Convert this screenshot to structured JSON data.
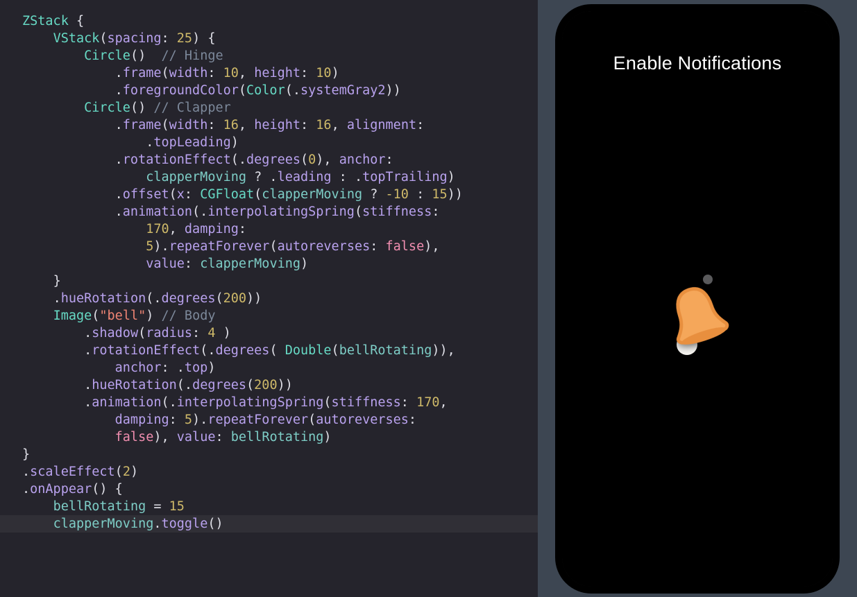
{
  "editor": {
    "lines": [
      {
        "i": 0,
        "seg": [
          {
            "c": "typeT",
            "t": "ZStack"
          },
          {
            "c": "op",
            "t": " {"
          }
        ]
      },
      {
        "i": 1,
        "seg": [
          {
            "c": "typeT",
            "t": "VStack"
          },
          {
            "c": "op",
            "t": "("
          },
          {
            "c": "typeP",
            "t": "spacing"
          },
          {
            "c": "op",
            "t": ": "
          },
          {
            "c": "num",
            "t": "25"
          },
          {
            "c": "op",
            "t": ") {"
          }
        ]
      },
      {
        "i": 2,
        "seg": [
          {
            "c": "typeT",
            "t": "Circle"
          },
          {
            "c": "op",
            "t": "()  "
          },
          {
            "c": "comm",
            "t": "// Hinge"
          }
        ]
      },
      {
        "i": 3,
        "seg": [
          {
            "c": "op",
            "t": "."
          },
          {
            "c": "typeP",
            "t": "frame"
          },
          {
            "c": "op",
            "t": "("
          },
          {
            "c": "typeP",
            "t": "width"
          },
          {
            "c": "op",
            "t": ": "
          },
          {
            "c": "num",
            "t": "10"
          },
          {
            "c": "op",
            "t": ", "
          },
          {
            "c": "typeP",
            "t": "height"
          },
          {
            "c": "op",
            "t": ": "
          },
          {
            "c": "num",
            "t": "10"
          },
          {
            "c": "op",
            "t": ")"
          }
        ]
      },
      {
        "i": 3,
        "seg": [
          {
            "c": "op",
            "t": "."
          },
          {
            "c": "typeP",
            "t": "foregroundColor"
          },
          {
            "c": "op",
            "t": "("
          },
          {
            "c": "typeT",
            "t": "Color"
          },
          {
            "c": "op",
            "t": "(."
          },
          {
            "c": "typeP",
            "t": "systemGray2"
          },
          {
            "c": "op",
            "t": "))"
          }
        ]
      },
      {
        "i": 0,
        "seg": [
          {
            "c": "op",
            "t": ""
          }
        ]
      },
      {
        "i": 2,
        "seg": [
          {
            "c": "typeT",
            "t": "Circle"
          },
          {
            "c": "op",
            "t": "() "
          },
          {
            "c": "comm",
            "t": "// Clapper"
          }
        ]
      },
      {
        "i": 3,
        "seg": [
          {
            "c": "op",
            "t": "."
          },
          {
            "c": "typeP",
            "t": "frame"
          },
          {
            "c": "op",
            "t": "("
          },
          {
            "c": "typeP",
            "t": "width"
          },
          {
            "c": "op",
            "t": ": "
          },
          {
            "c": "num",
            "t": "16"
          },
          {
            "c": "op",
            "t": ", "
          },
          {
            "c": "typeP",
            "t": "height"
          },
          {
            "c": "op",
            "t": ": "
          },
          {
            "c": "num",
            "t": "16"
          },
          {
            "c": "op",
            "t": ", "
          },
          {
            "c": "typeP",
            "t": "alignment"
          },
          {
            "c": "op",
            "t": ":"
          }
        ]
      },
      {
        "i": 4,
        "seg": [
          {
            "c": "op",
            "t": "."
          },
          {
            "c": "typeP",
            "t": "topLeading"
          },
          {
            "c": "op",
            "t": ")"
          }
        ]
      },
      {
        "i": 3,
        "seg": [
          {
            "c": "op",
            "t": "."
          },
          {
            "c": "typeP",
            "t": "rotationEffect"
          },
          {
            "c": "op",
            "t": "(."
          },
          {
            "c": "typeP",
            "t": "degrees"
          },
          {
            "c": "op",
            "t": "("
          },
          {
            "c": "num",
            "t": "0"
          },
          {
            "c": "op",
            "t": "), "
          },
          {
            "c": "typeP",
            "t": "anchor"
          },
          {
            "c": "op",
            "t": ":"
          }
        ]
      },
      {
        "i": 4,
        "seg": [
          {
            "c": "ident",
            "t": "clapperMoving"
          },
          {
            "c": "op",
            "t": " ? ."
          },
          {
            "c": "typeP",
            "t": "leading"
          },
          {
            "c": "op",
            "t": " : ."
          },
          {
            "c": "typeP",
            "t": "topTrailing"
          },
          {
            "c": "op",
            "t": ")"
          }
        ]
      },
      {
        "i": 3,
        "seg": [
          {
            "c": "op",
            "t": "."
          },
          {
            "c": "typeP",
            "t": "offset"
          },
          {
            "c": "op",
            "t": "("
          },
          {
            "c": "typeP",
            "t": "x"
          },
          {
            "c": "op",
            "t": ": "
          },
          {
            "c": "typeT",
            "t": "CGFloat"
          },
          {
            "c": "op",
            "t": "("
          },
          {
            "c": "ident",
            "t": "clapperMoving"
          },
          {
            "c": "op",
            "t": " ? "
          },
          {
            "c": "num",
            "t": "-10"
          },
          {
            "c": "op",
            "t": " : "
          },
          {
            "c": "num",
            "t": "15"
          },
          {
            "c": "op",
            "t": "))"
          }
        ]
      },
      {
        "i": 3,
        "seg": [
          {
            "c": "op",
            "t": "."
          },
          {
            "c": "typeP",
            "t": "animation"
          },
          {
            "c": "op",
            "t": "(."
          },
          {
            "c": "typeP",
            "t": "interpolatingSpring"
          },
          {
            "c": "op",
            "t": "("
          },
          {
            "c": "typeP",
            "t": "stiffness"
          },
          {
            "c": "op",
            "t": ":"
          }
        ]
      },
      {
        "i": 4,
        "seg": [
          {
            "c": "num",
            "t": "170"
          },
          {
            "c": "op",
            "t": ", "
          },
          {
            "c": "typeP",
            "t": "damping"
          },
          {
            "c": "op",
            "t": ":"
          }
        ]
      },
      {
        "i": 4,
        "seg": [
          {
            "c": "num",
            "t": "5"
          },
          {
            "c": "op",
            "t": ")."
          },
          {
            "c": "typeP",
            "t": "repeatForever"
          },
          {
            "c": "op",
            "t": "("
          },
          {
            "c": "typeP",
            "t": "autoreverses"
          },
          {
            "c": "op",
            "t": ": "
          },
          {
            "c": "kw",
            "t": "false"
          },
          {
            "c": "op",
            "t": "),"
          }
        ]
      },
      {
        "i": 4,
        "seg": [
          {
            "c": "typeP",
            "t": "value"
          },
          {
            "c": "op",
            "t": ": "
          },
          {
            "c": "ident",
            "t": "clapperMoving"
          },
          {
            "c": "op",
            "t": ")"
          }
        ]
      },
      {
        "i": 1,
        "seg": [
          {
            "c": "op",
            "t": "}"
          }
        ]
      },
      {
        "i": 1,
        "seg": [
          {
            "c": "op",
            "t": "."
          },
          {
            "c": "typeP",
            "t": "hueRotation"
          },
          {
            "c": "op",
            "t": "(."
          },
          {
            "c": "typeP",
            "t": "degrees"
          },
          {
            "c": "op",
            "t": "("
          },
          {
            "c": "num",
            "t": "200"
          },
          {
            "c": "op",
            "t": "))"
          }
        ]
      },
      {
        "i": 0,
        "seg": [
          {
            "c": "op",
            "t": ""
          }
        ]
      },
      {
        "i": 1,
        "seg": [
          {
            "c": "typeT",
            "t": "Image"
          },
          {
            "c": "op",
            "t": "("
          },
          {
            "c": "str",
            "t": "\"bell\""
          },
          {
            "c": "op",
            "t": ") "
          },
          {
            "c": "comm",
            "t": "// Body"
          }
        ]
      },
      {
        "i": 2,
        "seg": [
          {
            "c": "op",
            "t": "."
          },
          {
            "c": "typeP",
            "t": "shadow"
          },
          {
            "c": "op",
            "t": "("
          },
          {
            "c": "typeP",
            "t": "radius"
          },
          {
            "c": "op",
            "t": ": "
          },
          {
            "c": "num",
            "t": "4"
          },
          {
            "c": "op",
            "t": " )"
          }
        ]
      },
      {
        "i": 2,
        "seg": [
          {
            "c": "op",
            "t": "."
          },
          {
            "c": "typeP",
            "t": "rotationEffect"
          },
          {
            "c": "op",
            "t": "(."
          },
          {
            "c": "typeP",
            "t": "degrees"
          },
          {
            "c": "op",
            "t": "( "
          },
          {
            "c": "typeT",
            "t": "Double"
          },
          {
            "c": "op",
            "t": "("
          },
          {
            "c": "ident",
            "t": "bellRotating"
          },
          {
            "c": "op",
            "t": ")),"
          }
        ]
      },
      {
        "i": 3,
        "seg": [
          {
            "c": "typeP",
            "t": "anchor"
          },
          {
            "c": "op",
            "t": ": ."
          },
          {
            "c": "typeP",
            "t": "top"
          },
          {
            "c": "op",
            "t": ")"
          }
        ]
      },
      {
        "i": 2,
        "seg": [
          {
            "c": "op",
            "t": "."
          },
          {
            "c": "typeP",
            "t": "hueRotation"
          },
          {
            "c": "op",
            "t": "(."
          },
          {
            "c": "typeP",
            "t": "degrees"
          },
          {
            "c": "op",
            "t": "("
          },
          {
            "c": "num",
            "t": "200"
          },
          {
            "c": "op",
            "t": "))"
          }
        ]
      },
      {
        "i": 2,
        "seg": [
          {
            "c": "op",
            "t": "."
          },
          {
            "c": "typeP",
            "t": "animation"
          },
          {
            "c": "op",
            "t": "(."
          },
          {
            "c": "typeP",
            "t": "interpolatingSpring"
          },
          {
            "c": "op",
            "t": "("
          },
          {
            "c": "typeP",
            "t": "stiffness"
          },
          {
            "c": "op",
            "t": ": "
          },
          {
            "c": "num",
            "t": "170"
          },
          {
            "c": "op",
            "t": ","
          }
        ]
      },
      {
        "i": 3,
        "seg": [
          {
            "c": "typeP",
            "t": "damping"
          },
          {
            "c": "op",
            "t": ": "
          },
          {
            "c": "num",
            "t": "5"
          },
          {
            "c": "op",
            "t": ")."
          },
          {
            "c": "typeP",
            "t": "repeatForever"
          },
          {
            "c": "op",
            "t": "("
          },
          {
            "c": "typeP",
            "t": "autoreverses"
          },
          {
            "c": "op",
            "t": ":"
          }
        ]
      },
      {
        "i": 3,
        "seg": [
          {
            "c": "kw",
            "t": "false"
          },
          {
            "c": "op",
            "t": "), "
          },
          {
            "c": "typeP",
            "t": "value"
          },
          {
            "c": "op",
            "t": ": "
          },
          {
            "c": "ident",
            "t": "bellRotating"
          },
          {
            "c": "op",
            "t": ")"
          }
        ]
      },
      {
        "i": 0,
        "seg": [
          {
            "c": "op",
            "t": "}"
          }
        ]
      },
      {
        "i": 0,
        "seg": [
          {
            "c": "op",
            "t": "."
          },
          {
            "c": "typeP",
            "t": "scaleEffect"
          },
          {
            "c": "op",
            "t": "("
          },
          {
            "c": "num",
            "t": "2"
          },
          {
            "c": "op",
            "t": ")"
          }
        ]
      },
      {
        "i": 0,
        "seg": [
          {
            "c": "op",
            "t": "."
          },
          {
            "c": "typeP",
            "t": "onAppear"
          },
          {
            "c": "op",
            "t": "() {"
          }
        ]
      },
      {
        "i": 1,
        "seg": [
          {
            "c": "ident",
            "t": "bellRotating"
          },
          {
            "c": "op",
            "t": " = "
          },
          {
            "c": "num",
            "t": "15"
          }
        ]
      },
      {
        "i": 1,
        "hl": true,
        "seg": [
          {
            "c": "ident",
            "t": "clapperMoving"
          },
          {
            "c": "op",
            "t": "."
          },
          {
            "c": "typeP",
            "t": "toggle"
          },
          {
            "c": "op",
            "t": "()"
          }
        ]
      }
    ],
    "indentUnit": "    "
  },
  "preview": {
    "title": "Enable Notifications"
  }
}
